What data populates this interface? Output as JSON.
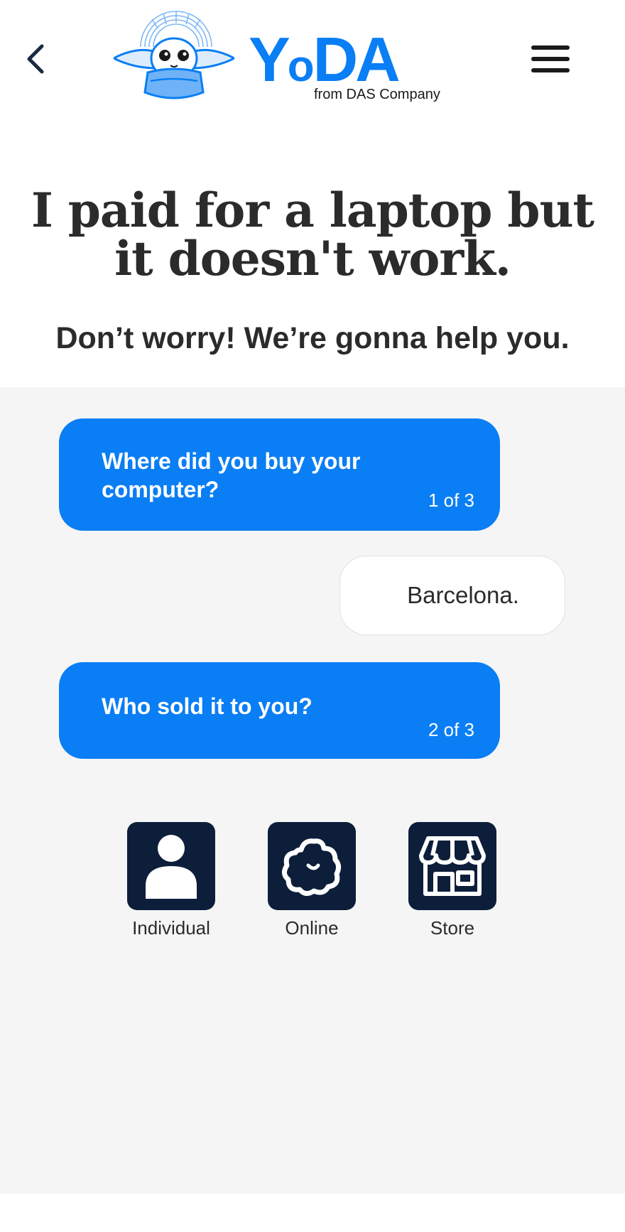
{
  "header": {
    "logo_word_big": "Y",
    "logo_word_small": "o",
    "logo_word_rest": "DA",
    "logo_sub": "from DAS Company",
    "icons": {
      "back": "chevron-left-icon",
      "menu": "hamburger-menu-icon"
    },
    "brand_color": "#0a7ef4"
  },
  "hero": {
    "title": "I paid for a laptop but it doesn't work.",
    "subtitle": "Don’t worry! We’re gonna help you."
  },
  "chat": {
    "messages": [
      {
        "role": "question",
        "text": "Where did you buy your computer?",
        "counter": "1 of 3"
      },
      {
        "role": "answer",
        "text": "Barcelona."
      },
      {
        "role": "question",
        "text": "Who sold it to you?",
        "counter": "2 of 3"
      }
    ],
    "options": [
      {
        "label": "Individual",
        "icon": "person-icon"
      },
      {
        "label": "Online",
        "icon": "cloud-icon"
      },
      {
        "label": "Store",
        "icon": "storefront-icon"
      }
    ],
    "bubble_color": "#0a7ef4",
    "tile_color": "#0c1e3a",
    "panel_bg": "#f5f5f5"
  }
}
